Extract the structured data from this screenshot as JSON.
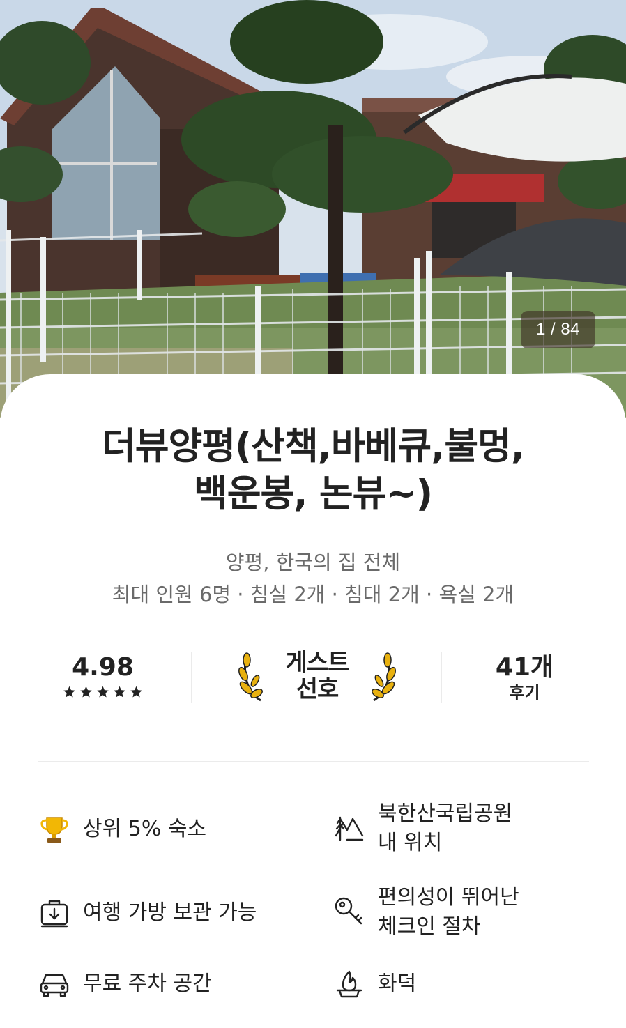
{
  "hero": {
    "photo_counter": "1 / 84"
  },
  "listing": {
    "title_line1": "더뷰양평(산책,바베큐,불멍,",
    "title_line2": "백운봉, 논뷰~)",
    "subtitle": "양평, 한국의 집 전체",
    "capacity": "최대 인원 6명 · 침실 2개 · 침대 2개 · 욕실 2개"
  },
  "stats": {
    "rating": "4.98",
    "star_count": 5,
    "guest_favorite_line1": "게스트",
    "guest_favorite_line2": "선호",
    "reviews_count": "41개",
    "reviews_label": "후기"
  },
  "amenities": [
    {
      "icon": "trophy-icon",
      "line1": "상위 5% 숙소",
      "line2": ""
    },
    {
      "icon": "mountain-icon",
      "line1": "북한산국립공원",
      "line2": "내 위치"
    },
    {
      "icon": "luggage-icon",
      "line1": "여행 가방 보관 가능",
      "line2": ""
    },
    {
      "icon": "key-icon",
      "line1": "편의성이 뛰어난",
      "line2": "체크인 절차"
    },
    {
      "icon": "car-icon",
      "line1": "무료 주차 공간",
      "line2": ""
    },
    {
      "icon": "fire-pit-icon",
      "line1": "화덕",
      "line2": ""
    }
  ],
  "colors": {
    "text_primary": "#222222",
    "text_secondary": "#6a6a6a",
    "divider": "#ebebeb",
    "gold": "#e8b10f"
  }
}
